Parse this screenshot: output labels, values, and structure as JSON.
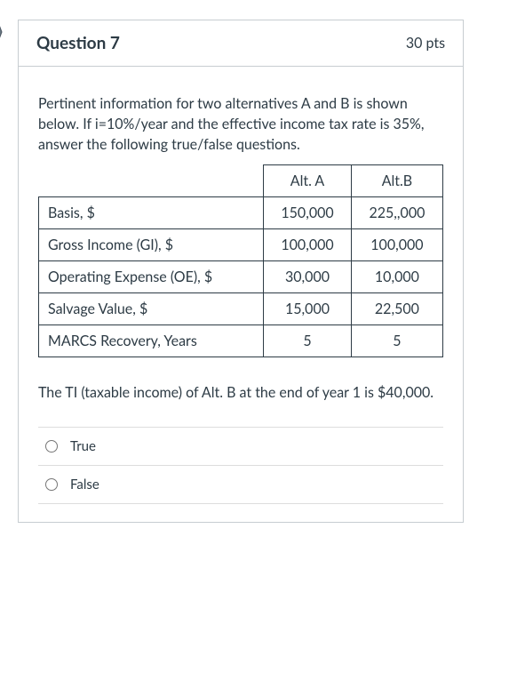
{
  "header": {
    "title": "Question 7",
    "points": "30 pts"
  },
  "intro": "Pertinent information for two alternatives A and B is shown below.  If i=10%/year and the effective income tax rate is 35%, answer the following true/false questions.",
  "table": {
    "headers": {
      "c0": "",
      "c1": "Alt. A",
      "c2": "Alt.B"
    },
    "rows": [
      {
        "label": "Basis, $",
        "a": "150,000",
        "b": "225,,000"
      },
      {
        "label": "Gross Income (GI), $",
        "a": "100,000",
        "b": "100,000"
      },
      {
        "label": "Operating Expense (OE), $",
        "a": "30,000",
        "b": "10,000"
      },
      {
        "label": "Salvage Value, $",
        "a": "15,000",
        "b": "22,500"
      },
      {
        "label": "MARCS Recovery, Years",
        "a": "5",
        "b": "5"
      }
    ]
  },
  "statement": "The TI (taxable income) of Alt. B at the end of year 1 is $40,000.",
  "options": {
    "true_label": "True",
    "false_label": "False"
  }
}
